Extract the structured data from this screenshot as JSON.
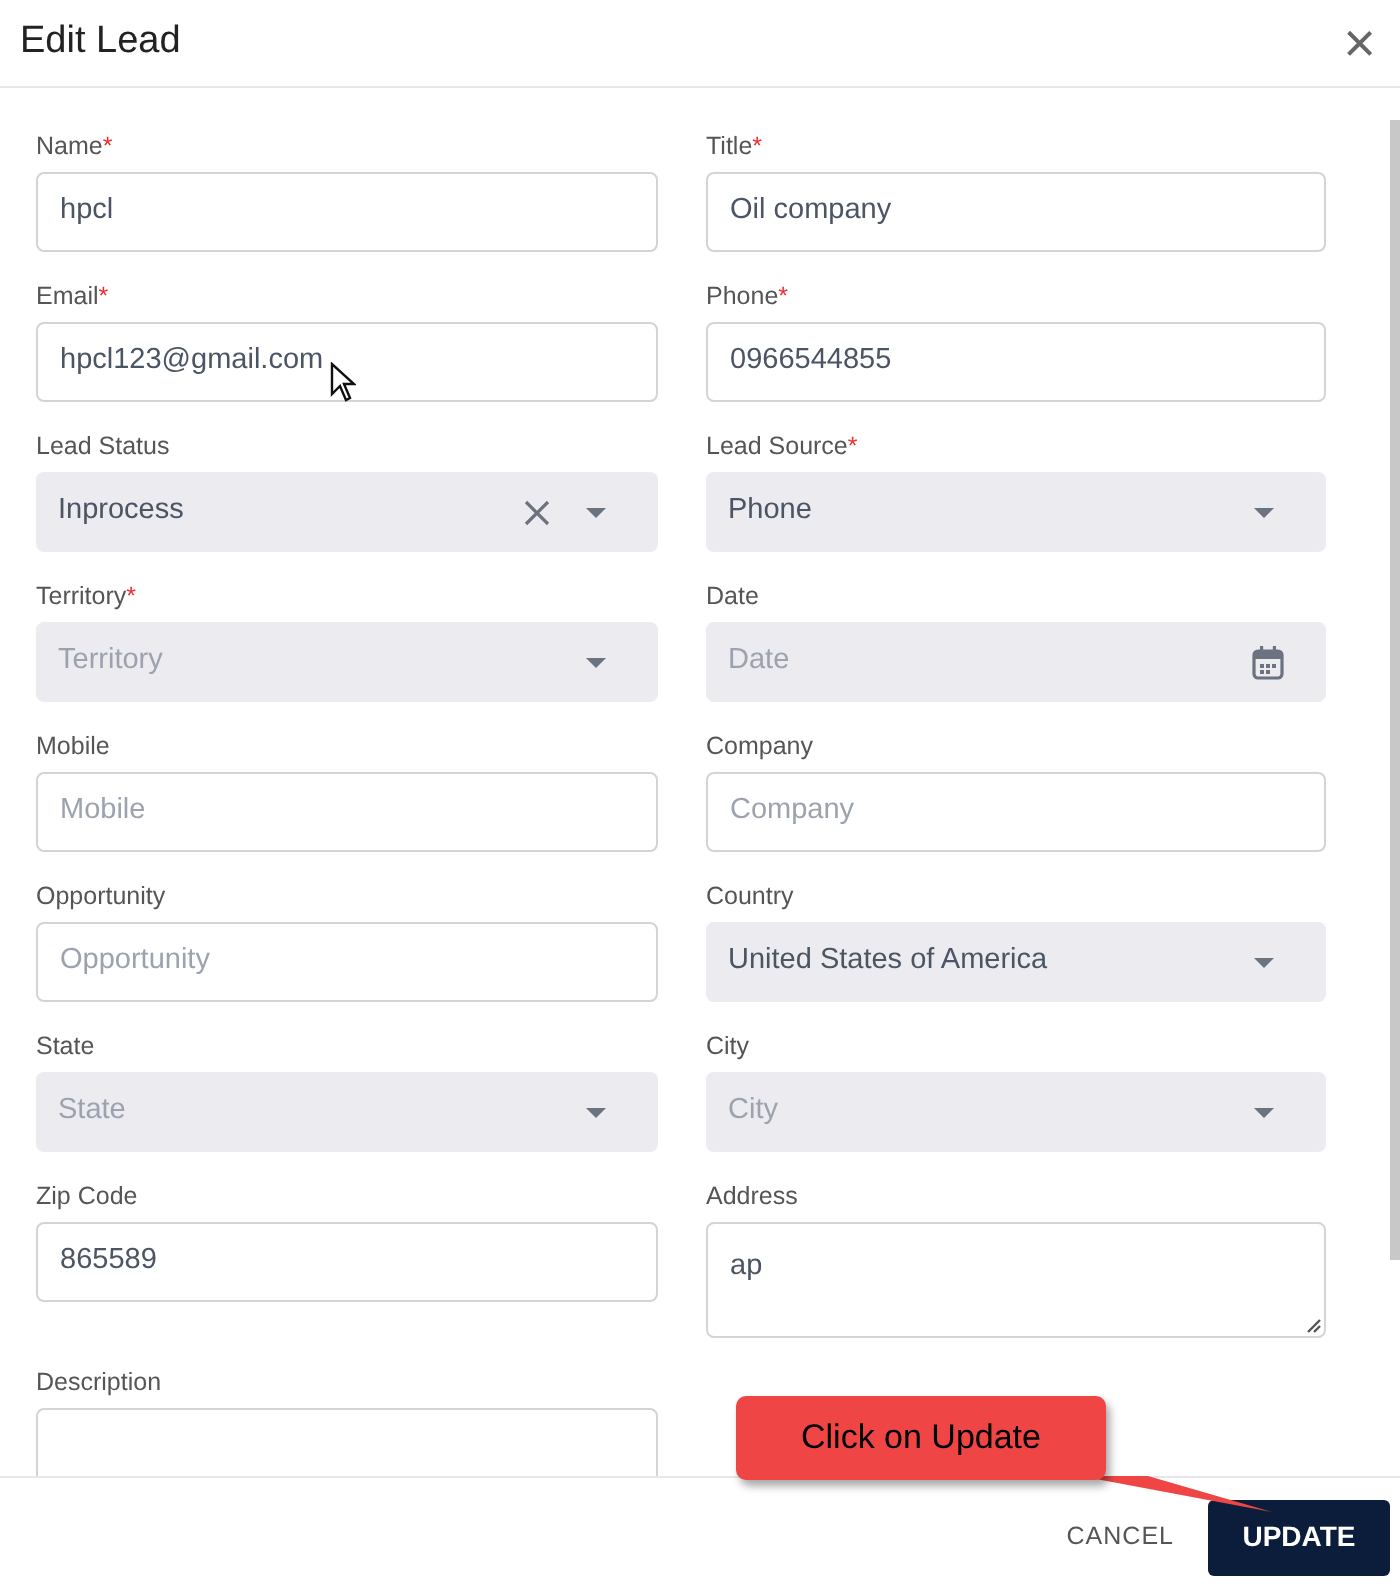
{
  "dialog": {
    "title": "Edit Lead",
    "close": "×"
  },
  "fields": [
    {
      "label": "Name",
      "required_mark": "*",
      "kind": "text",
      "value": "hpcl"
    },
    {
      "label": "Title",
      "required_mark": "*",
      "kind": "text",
      "value": "Oil company"
    },
    {
      "label": "Email",
      "required_mark": "*",
      "kind": "text",
      "value": "hpcl123@gmail.com"
    },
    {
      "label": "Phone",
      "required_mark": "*",
      "kind": "text",
      "value": "0966544855"
    },
    {
      "label": "Lead Status",
      "kind": "select",
      "value": "Inprocess",
      "clearable": true
    },
    {
      "label": "Lead Source",
      "required_mark": "*",
      "kind": "select",
      "value": "Phone"
    },
    {
      "label": "Territory",
      "required_mark": "*",
      "kind": "select",
      "placeholder": "Territory"
    },
    {
      "label": "Date",
      "kind": "date",
      "placeholder": "Date"
    },
    {
      "label": "Mobile",
      "kind": "text",
      "placeholder": "Mobile"
    },
    {
      "label": "Company",
      "kind": "text",
      "placeholder": "Company"
    },
    {
      "label": "Opportunity",
      "kind": "text",
      "placeholder": "Opportunity"
    },
    {
      "label": "Country",
      "kind": "select",
      "value": "United States of America"
    },
    {
      "label": "State",
      "kind": "select",
      "placeholder": "State"
    },
    {
      "label": "City",
      "kind": "select",
      "placeholder": "City"
    },
    {
      "label": "Zip Code",
      "kind": "text",
      "value": "865589"
    },
    {
      "label": "Address",
      "kind": "textarea",
      "value": "ap",
      "resize_handle": true
    },
    {
      "label": "Description",
      "kind": "textarea"
    }
  ],
  "footer": {
    "buttons": [
      {
        "label": "CANCEL",
        "kind": "text"
      },
      {
        "label": "UPDATE",
        "kind": "primary"
      }
    ]
  },
  "callout": {
    "text": "Click on Update"
  }
}
